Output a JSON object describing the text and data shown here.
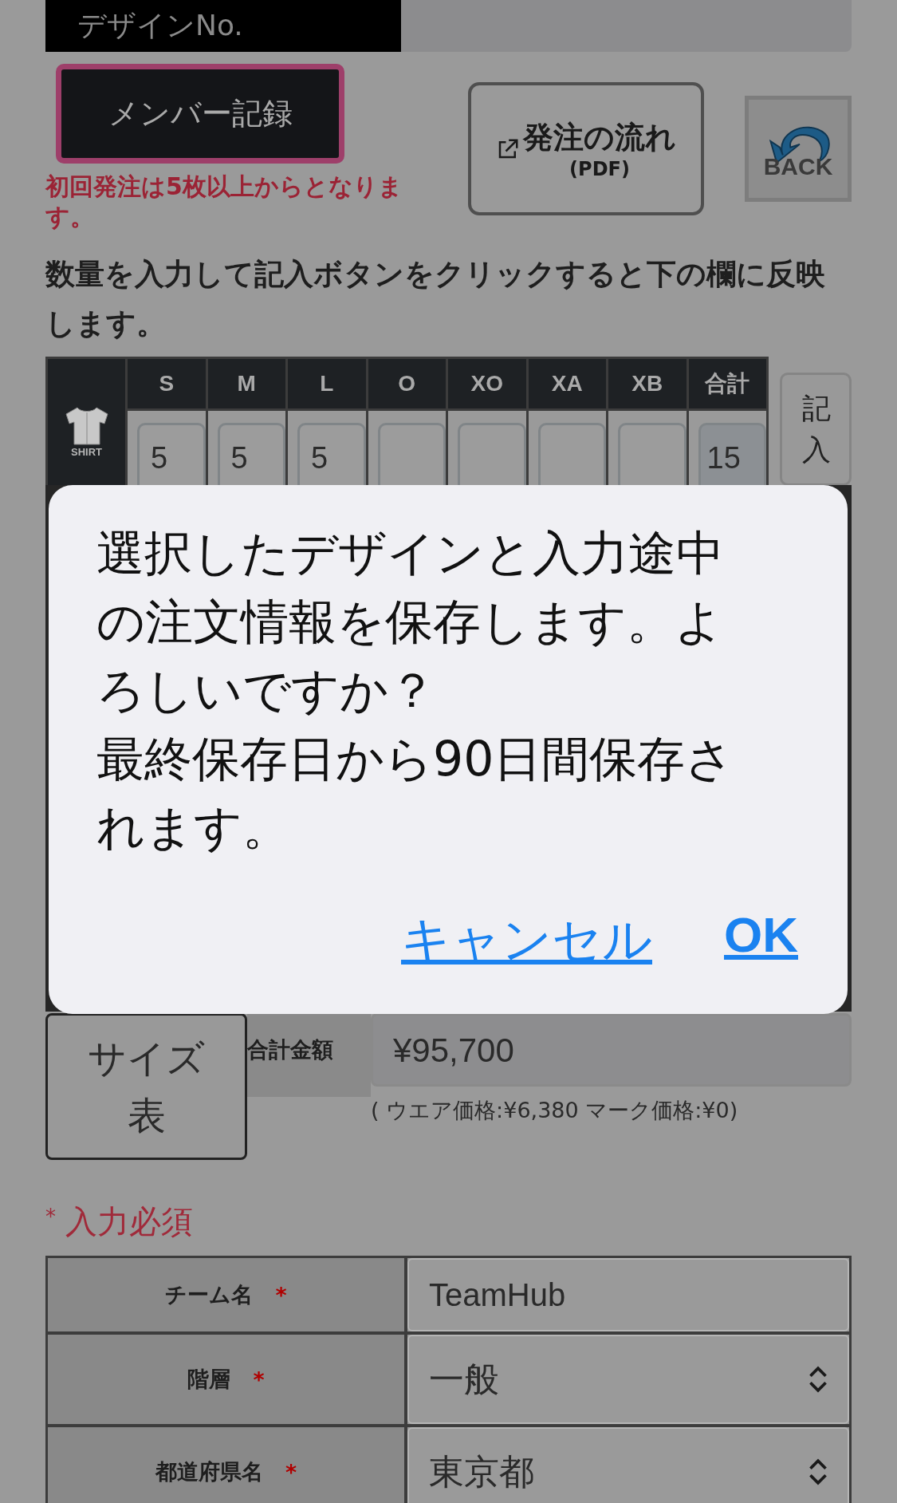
{
  "design_no": {
    "label": "デザインNo."
  },
  "member_button": {
    "label": "メンバー記録"
  },
  "notice": "初回発注は5枚以上からとなります。",
  "flow_button": {
    "title": "発注の流れ",
    "subtitle": "(PDF)"
  },
  "back_button": {
    "label": "BACK"
  },
  "instruction": "数量を入力して記入ボタンをクリックすると下の欄に反映します。",
  "size_table": {
    "item_label": "SHIRT",
    "sizes": [
      {
        "label": "S",
        "value": "5"
      },
      {
        "label": "M",
        "value": "5"
      },
      {
        "label": "L",
        "value": "5"
      },
      {
        "label": "O"
      },
      {
        "label": "XO"
      },
      {
        "label": "XA"
      },
      {
        "label": "XB"
      }
    ],
    "total": {
      "label": "合計",
      "value": "15"
    },
    "enter_button": "記入"
  },
  "dialog": {
    "message_lines": [
      "選択したデザインと入力途中の注文情報を保存します。よろしいですか？",
      "最終保存日から90日間保存されます。"
    ],
    "buttons": [
      {
        "label": "キャンセル",
        "kind": "cancel"
      },
      {
        "label": "OK",
        "kind": "ok"
      }
    ]
  },
  "size_chart_button": "サイズ表",
  "total_amount": {
    "label": "合計金額",
    "value": "¥95,700",
    "breakdown": "( ウエア価格:¥6,380 マーク価格:¥0)"
  },
  "required_note": {
    "mark": "*",
    "text": "入力必須"
  },
  "form_rows": [
    {
      "label": "チーム名",
      "required_mark": "*",
      "kind": "text",
      "value": "TeamHub"
    },
    {
      "label": "階層",
      "required_mark": "*",
      "kind": "select",
      "value": "一般"
    },
    {
      "label": "都道府県名",
      "required_mark": "*",
      "kind": "select",
      "value": "東京都"
    }
  ]
}
